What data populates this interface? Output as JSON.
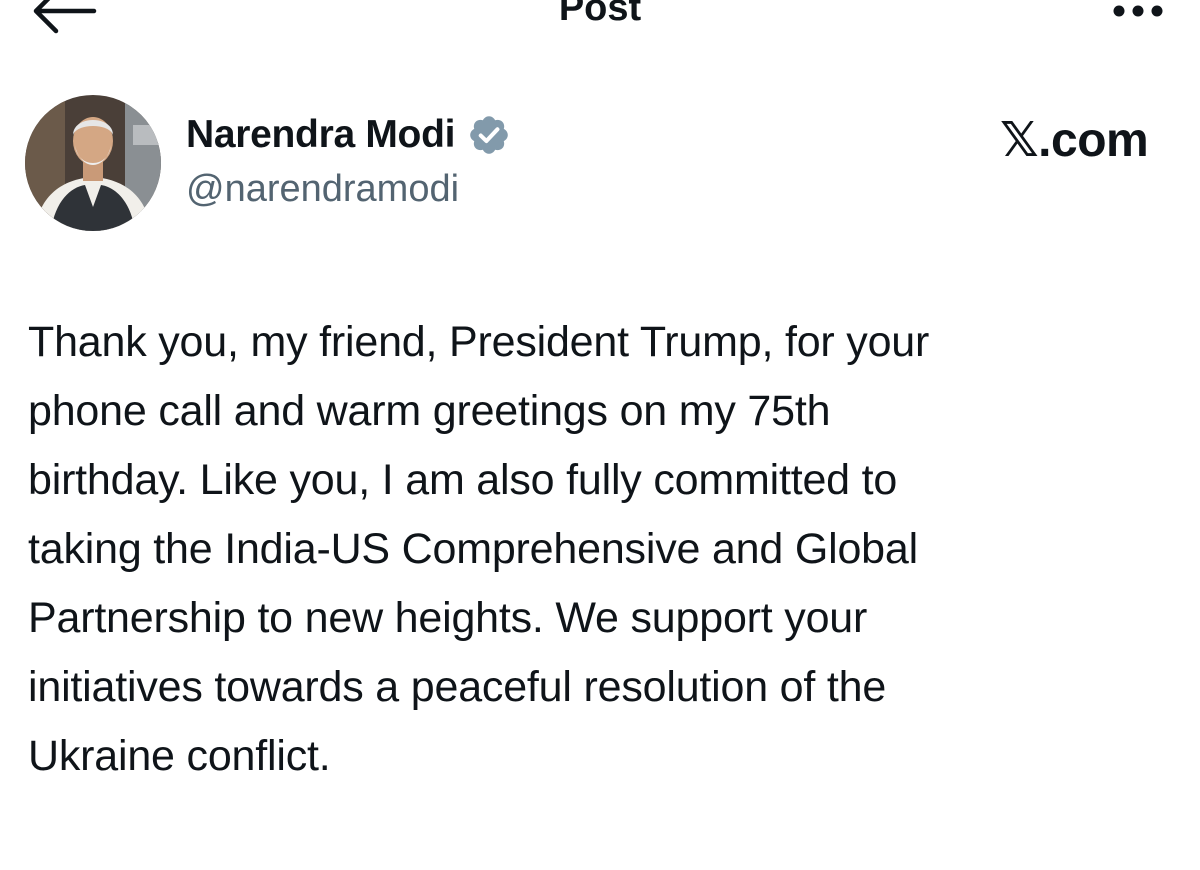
{
  "header": {
    "title": "Post",
    "back_icon": "arrow-left-icon",
    "more_icon": "more-horizontal-icon"
  },
  "author": {
    "name": "Narendra Modi",
    "handle": "@narendramodi",
    "verified_icon": "verified-badge-icon",
    "verified_color": "#829aab"
  },
  "source": {
    "label": "𝕏.com"
  },
  "post": {
    "text": "Thank you, my friend, President Trump, for your\nphone call and warm greetings on my 75th\nbirthday. Like you, I am also fully committed to\ntaking the India-US Comprehensive and Global\nPartnership to new heights. We support your\ninitiatives towards a peaceful resolution of the\nUkraine conflict."
  },
  "colors": {
    "text_primary": "#0f1419",
    "text_secondary": "#536471",
    "background": "#ffffff"
  }
}
